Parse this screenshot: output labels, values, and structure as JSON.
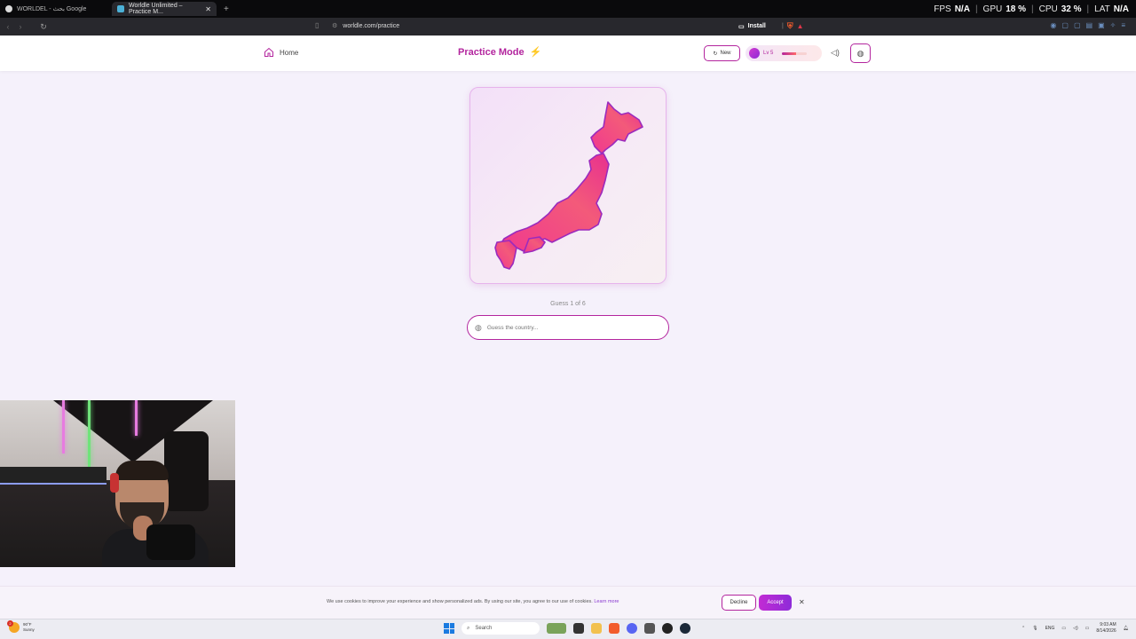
{
  "browser": {
    "tabs": [
      {
        "title": "WORLDEL - بحث Google",
        "active": false
      },
      {
        "title": "Worldle Unlimited – Practice M...",
        "active": true
      }
    ],
    "url": "worldle.com/practice",
    "install_label": "Install",
    "perf": {
      "fps_label": "FPS",
      "fps": "N/A",
      "gpu_label": "GPU",
      "gpu": "18 %",
      "cpu_label": "CPU",
      "cpu": "32 %",
      "lat_label": "LAT",
      "lat": "N/A"
    }
  },
  "header": {
    "home_label": "Home",
    "title": "Practice Mode",
    "title_icon": "lightning-bolt",
    "new_label": "New",
    "level_label": "Lv 5",
    "xp_fraction": 0.55,
    "accent_color": "#b3259e"
  },
  "game": {
    "country_shape": "Japan",
    "guess_status": "Guess 1 of 6",
    "input_placeholder": "Guess the country..."
  },
  "cookie": {
    "text": "We use cookies to improve your experience and show personalized ads. By using our site, you agree to our use of cookies.",
    "learn_more": "Learn more",
    "decline_label": "Decline",
    "accept_label": "Accept"
  },
  "taskbar": {
    "weather_temp": "90°F",
    "weather_desc": "Sunny",
    "weather_badge": "2",
    "search_label": "Search",
    "lang": "ENG",
    "time": "9:03 AM",
    "date": "8/14/2026"
  }
}
